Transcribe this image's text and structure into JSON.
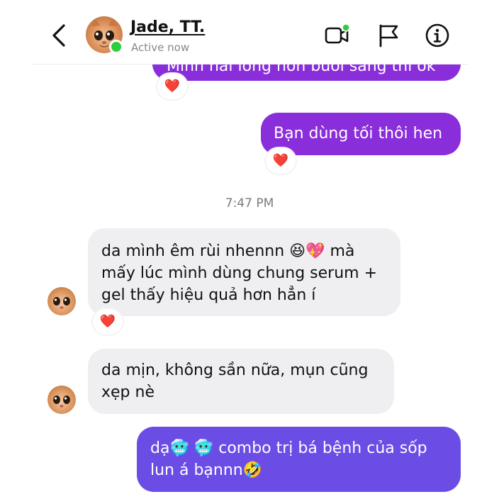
{
  "header": {
    "contact_name": "Jade, TT.",
    "status": "Active now"
  },
  "messages": {
    "partial_top": "Mình hài lòng hơn buổi sáng thì ok",
    "out_1": "Bạn dùng tối thôi hen",
    "timestamp": "7:47 PM",
    "in_1_line1": "da mình êm rùi nhennn 😆💖 mà",
    "in_1_line2": "mấy lúc mình dùng chung serum +",
    "in_1_line3": "gel thấy hiệu quả hơn hẳn í",
    "in_2_line1": "da mịn, không sần nữa, mụn cũng",
    "in_2_line2": "xẹp nè",
    "out_2_line1": "dạ🥶 🥶 combo trị bá bệnh của sốp",
    "out_2_line2": "lun á bạnnn🤣",
    "reaction": "❤️"
  },
  "colors": {
    "bubble_purple": "#8a2ddb",
    "bubble_violet": "#6b4de6",
    "incoming_bg": "#efeff1",
    "online": "#2ecc3f"
  },
  "icons": [
    "back-arrow-icon",
    "video-call-icon",
    "flag-icon",
    "info-icon",
    "heart-reaction-icon"
  ]
}
